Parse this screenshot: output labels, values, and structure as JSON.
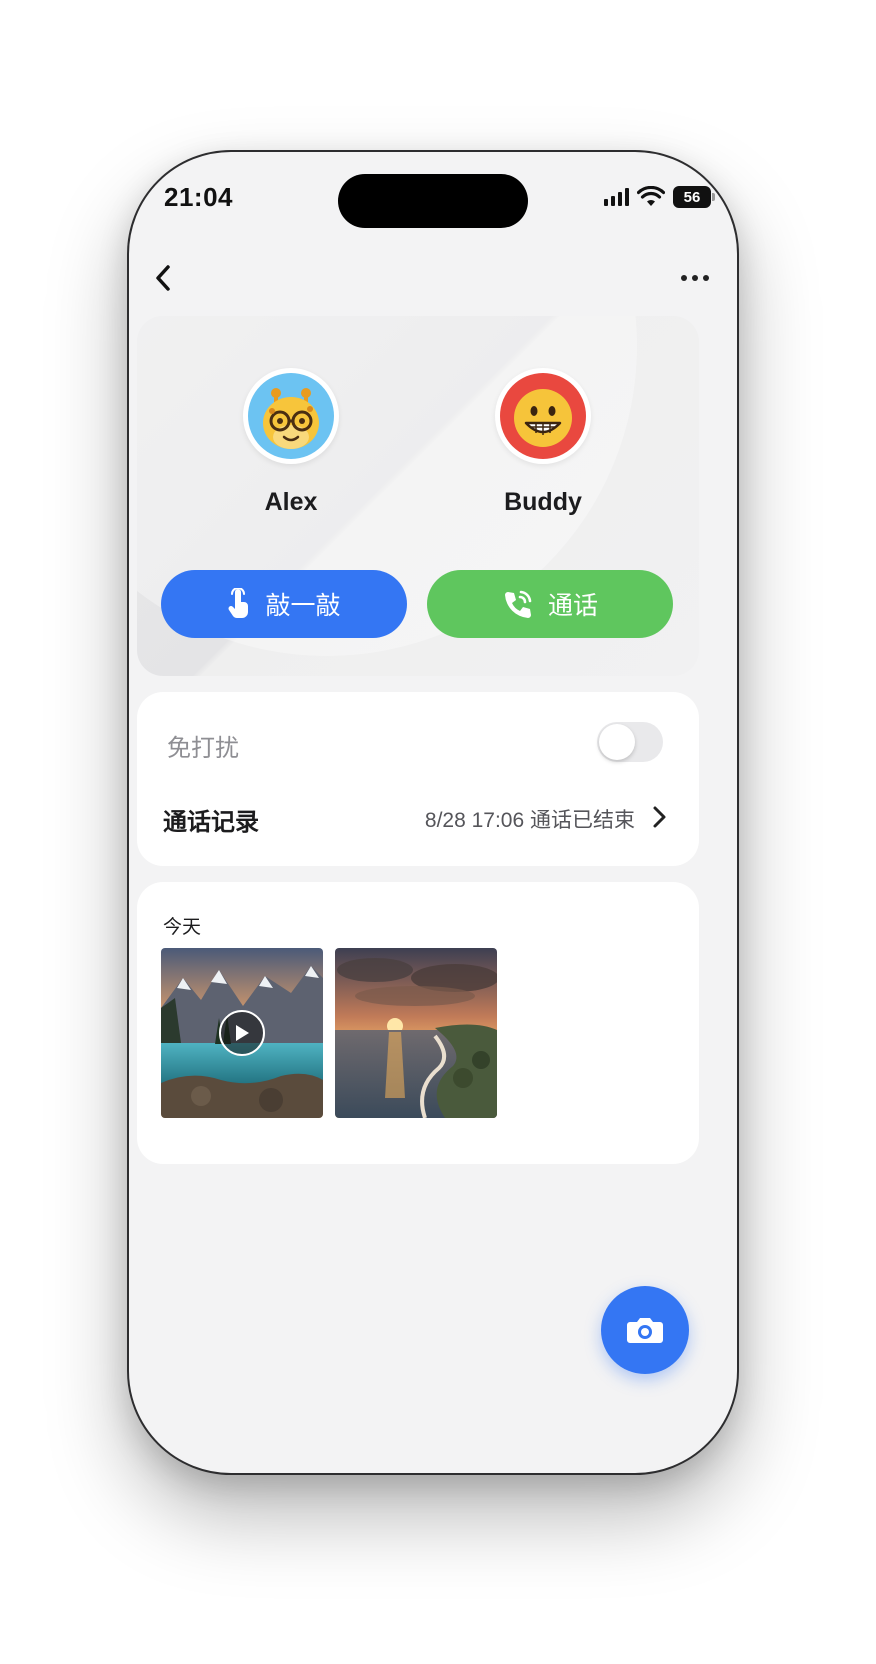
{
  "status_bar": {
    "time": "21:04",
    "battery": "56",
    "icons": [
      "signal-icon",
      "wifi-icon",
      "battery-icon"
    ]
  },
  "nav": {
    "back_icon": "chevron-left-icon",
    "more_icon": "more-horizontal-icon"
  },
  "profiles": [
    {
      "name": "Alex",
      "avatar": "giraffe-avatar"
    },
    {
      "name": "Buddy",
      "avatar": "grinning-face-avatar"
    }
  ],
  "actions": {
    "tap_label": "敲一敲",
    "tap_icon": "finger-tap-icon",
    "tap_color": "#3476f3",
    "call_label": "通话",
    "call_icon": "phone-ringing-icon",
    "call_color": "#5fc65e"
  },
  "settings": {
    "dnd_label": "免打扰",
    "dnd_enabled": false,
    "call_log_label": "通话记录",
    "call_log_value": "8/28 17:06 通话已结束"
  },
  "media": {
    "day_label": "今天",
    "items": [
      {
        "type": "video",
        "subject": "mountain-lake"
      },
      {
        "type": "photo",
        "subject": "sunset-coast"
      }
    ]
  },
  "fab": {
    "icon": "camera-icon",
    "color": "#3476f3"
  }
}
